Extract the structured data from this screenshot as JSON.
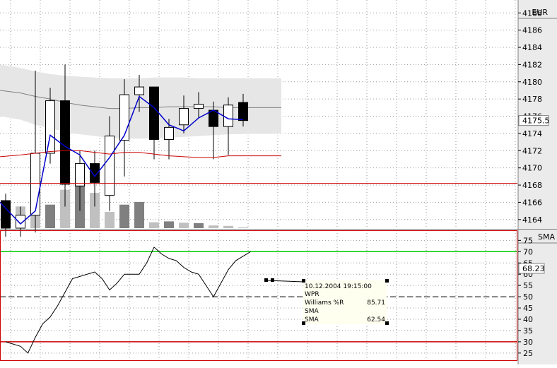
{
  "colors": {
    "grid": "#9a9a9a",
    "axis_bg": "#ebebeb",
    "band": "#e6e6e6",
    "bull_body": "#ffffff",
    "bear_body": "#000000",
    "wick": "#000000",
    "sma_line": "#0000cc",
    "mid_line": "#808080",
    "trend_line": "#cc0000",
    "level_line": "#cc0000",
    "green_level": "#00cc00",
    "tooltip_bg": "#fffff0"
  },
  "price_axis": {
    "label": "EUR",
    "ticks": [
      "4188",
      "4186",
      "4184",
      "4182",
      "4180",
      "4178",
      "4176",
      "4174",
      "4172",
      "4170",
      "4168",
      "4166",
      "4164"
    ],
    "current_label": "4175.5"
  },
  "indicator_axis": {
    "label": "SMA",
    "ticks": [
      "75",
      "70",
      "65",
      "60",
      "55",
      "50",
      "45",
      "40",
      "35",
      "30",
      "25"
    ],
    "current_label": "68.23"
  },
  "tooltip": {
    "datetime": "10.12.2004 19:15:00",
    "rows": [
      {
        "label": "WPR",
        "value": ""
      },
      {
        "label": "Williams %R",
        "value": "85.71"
      },
      {
        "label": "SMA",
        "value": ""
      },
      {
        "label": "SMA",
        "value": "62.54"
      }
    ]
  },
  "chart_data": [
    {
      "type": "candlestick",
      "ylim": [
        4163,
        4189.5
      ],
      "resistance_level": 4168.2,
      "candles": [
        {
          "o": 4166.2,
          "h": 4167.0,
          "l": 4162.0,
          "c": 4163.0
        },
        {
          "o": 4163.0,
          "h": 4165.5,
          "l": 4162.0,
          "c": 4164.5
        },
        {
          "o": 4164.5,
          "h": 4181.3,
          "l": 4162.5,
          "c": 4171.7
        },
        {
          "o": 4171.7,
          "h": 4179.3,
          "l": 4170.5,
          "c": 4177.8
        },
        {
          "o": 4177.8,
          "h": 4182.0,
          "l": 4165.5,
          "c": 4168.1
        },
        {
          "o": 4167.9,
          "h": 4172.0,
          "l": 4165.0,
          "c": 4170.5
        },
        {
          "o": 4170.5,
          "h": 4172.0,
          "l": 4165.5,
          "c": 4168.3
        },
        {
          "o": 4166.8,
          "h": 4176.0,
          "l": 4165.0,
          "c": 4173.7
        },
        {
          "o": 4173.2,
          "h": 4180.3,
          "l": 4169.0,
          "c": 4178.5
        },
        {
          "o": 4178.5,
          "h": 4180.8,
          "l": 4176.5,
          "c": 4179.4
        },
        {
          "o": 4179.4,
          "h": 4179.4,
          "l": 4171.0,
          "c": 4173.3
        },
        {
          "o": 4173.3,
          "h": 4175.7,
          "l": 4171.0,
          "c": 4174.7
        },
        {
          "o": 4175.0,
          "h": 4178.4,
          "l": 4174.0,
          "c": 4176.9
        },
        {
          "o": 4176.9,
          "h": 4178.8,
          "l": 4175.8,
          "c": 4177.4
        },
        {
          "o": 4176.7,
          "h": 4177.7,
          "l": 4171.0,
          "c": 4174.8
        },
        {
          "o": 4174.8,
          "h": 4178.2,
          "l": 4171.5,
          "c": 4177.3
        },
        {
          "o": 4177.6,
          "h": 4178.6,
          "l": 4174.8,
          "c": 4175.5
        }
      ],
      "sma": [
        4166.0,
        4163.5,
        4165.0,
        4173.8,
        4172.5,
        4171.5,
        4169.0,
        4171.2,
        4173.8,
        4178.3,
        4177.0,
        4175.0,
        4174.3,
        4175.8,
        4176.7,
        4175.7,
        4175.6
      ],
      "band_upper": [
        4182.0,
        4181.6,
        4181.2,
        4180.9,
        4180.7,
        4180.6,
        4180.5,
        4180.4,
        4180.4,
        4180.4,
        4180.5,
        4180.5,
        4180.5,
        4180.4,
        4180.4,
        4180.4,
        4180.4
      ],
      "band_mid": [
        4179.0,
        4178.7,
        4178.3,
        4178.0,
        4177.6,
        4177.3,
        4177.1,
        4176.9,
        4176.9,
        4177.0,
        4177.0,
        4177.1,
        4177.1,
        4177.1,
        4177.1,
        4177.0,
        4177.0
      ],
      "band_lower": [
        4176.0,
        4175.6,
        4175.0,
        4174.6,
        4174.2,
        4173.9,
        4173.7,
        4173.5,
        4173.4,
        4173.4,
        4173.4,
        4173.5,
        4173.6,
        4173.7,
        4173.8,
        4173.9,
        4174.0
      ],
      "trend_line": [
        4171.3,
        4171.5,
        4171.7,
        4171.9,
        4172.0,
        4172.0,
        4171.8,
        4171.6,
        4171.8,
        4171.8,
        4171.6,
        4171.4,
        4171.3,
        4171.2,
        4171.2,
        4171.4,
        4171.4
      ],
      "volume": [
        0.55,
        0.48,
        0.48,
        0.52,
        0.85,
        1.0,
        0.78,
        0.36,
        0.52,
        0.58,
        0.13,
        0.15,
        0.12,
        0.11,
        0.06,
        0.05,
        0.0
      ]
    },
    {
      "type": "line",
      "series_name": "Williams %R",
      "ylim": [
        21.5,
        79.5
      ],
      "levels": {
        "upper": 70,
        "mid": 50,
        "lower": 30
      },
      "x": [
        0.0,
        1.0,
        1.5,
        2.0,
        2.5,
        3.0,
        3.5,
        4.0,
        4.5,
        5.0,
        5.5,
        6.0,
        6.5,
        7.0,
        7.5,
        8.0,
        8.5,
        9.0,
        9.5,
        10.0,
        10.5,
        11.0,
        11.5,
        12.0,
        12.5,
        13.0,
        13.5,
        14.0,
        14.5,
        15.0,
        15.5,
        16.0,
        16.5
      ],
      "values": [
        30,
        28,
        25,
        32,
        38,
        41,
        46,
        52,
        58,
        59,
        60,
        61,
        58,
        53,
        56,
        60,
        60,
        60,
        65,
        72,
        69,
        67,
        66,
        63,
        61,
        60,
        55,
        50,
        56,
        62,
        66,
        68,
        70
      ]
    }
  ]
}
